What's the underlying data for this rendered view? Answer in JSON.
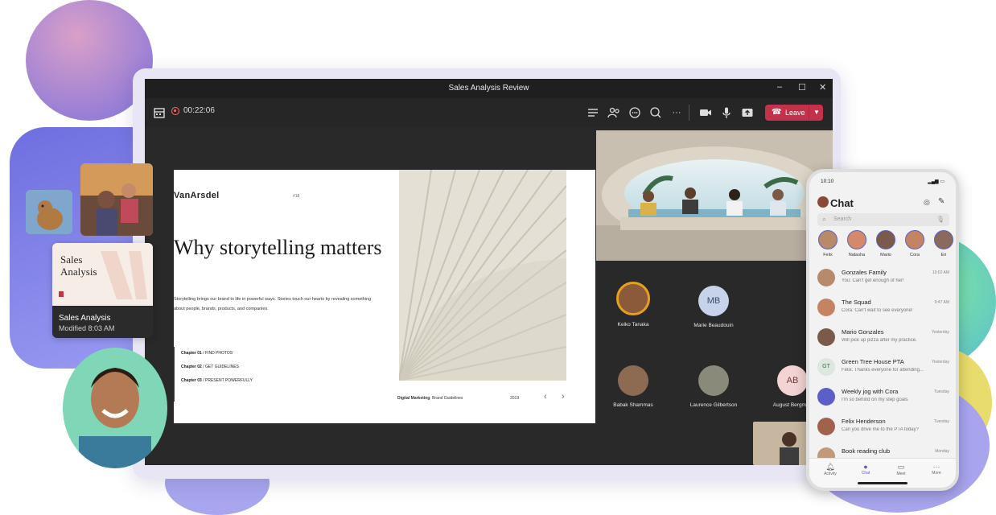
{
  "window": {
    "title": "Sales Analysis Review",
    "minimize": "–",
    "maximize": "☐",
    "close": "✕"
  },
  "toolbar": {
    "timer": "00:22:06",
    "leave_label": "Leave",
    "icons": [
      "calendar-icon",
      "record-icon",
      "chat-list-icon",
      "people-icon",
      "chat-bubble-icon",
      "reactions-icon",
      "more-icon",
      "camera-icon",
      "mic-icon",
      "share-icon"
    ],
    "more_glyph": "···"
  },
  "slide": {
    "brand": "VanArsdel",
    "page_label": "#18",
    "heading": "Why storytelling matters",
    "body": "Storytelling brings our brand to life in powerful ways. Stories touch our hearts by revealing something about people, brands, products, and companies.",
    "chapters": [
      {
        "num": "Chapter 01",
        "title": "/ FIND PHOTOS"
      },
      {
        "num": "Chapter 02",
        "title": "/ GET GUIDELINES"
      },
      {
        "num": "Chapter 03",
        "title": "/ PRESENT POWERFULLY"
      }
    ],
    "footer_left": "Digital Marketing",
    "footer_mid": "Brand Guidelines",
    "footer_year": "2019"
  },
  "participants": [
    {
      "name": "Keiko Tanaka",
      "initials": "",
      "color": "#d9a441"
    },
    {
      "name": "Marie Beaudouin",
      "initials": "MB",
      "color": "#c7d3ea"
    },
    {
      "name": "Babak Shammas",
      "initials": "",
      "color": "#8c6b52"
    },
    {
      "name": "Laurence Gilbertson",
      "initials": "",
      "color": "#8a8a7a"
    },
    {
      "name": "August Bergman",
      "initials": "AB",
      "color": "#f3d3d3"
    }
  ],
  "files": {
    "thumb_title": "Sales Analysis",
    "name": "Sales Analysis",
    "modified": "Modified 8:03 AM"
  },
  "phone": {
    "time": "10:10",
    "title": "Chat",
    "search_placeholder": "Search",
    "stories": [
      "Felix",
      "Natasha",
      "Mario",
      "Cora",
      "Eri"
    ],
    "chats": [
      {
        "name": "Gonzales Family",
        "preview": "You: Can't get enough of her!",
        "time": "10:02 AM",
        "color": "#b68a6a"
      },
      {
        "name": "The Squad",
        "preview": "Cora: Can't wait to see everyone!",
        "time": "9:47 AM",
        "color": "#c48463"
      },
      {
        "name": "Mario Gonzales",
        "preview": "Will pick up pizza after my practice.",
        "time": "Yesterday",
        "color": "#7a5a4a"
      },
      {
        "name": "Green Tree House PTA",
        "preview": "Felix: Thanks everyone for attending...",
        "time": "Yesterday",
        "color": "#dce8de",
        "initials": "GT"
      },
      {
        "name": "Weekly jog with Cora",
        "preview": "I'm so behind on my step goals",
        "time": "Tuesday",
        "color": "#5b5fc7"
      },
      {
        "name": "Felix Henderson",
        "preview": "Can you drive me to the PTA today?",
        "time": "Tuesday",
        "color": "#a0624a"
      },
      {
        "name": "Book reading club",
        "preview": "",
        "time": "Monday",
        "color": "#c09a7a"
      }
    ],
    "nav": [
      "Activity",
      "Chat",
      "Meet",
      "More"
    ]
  }
}
